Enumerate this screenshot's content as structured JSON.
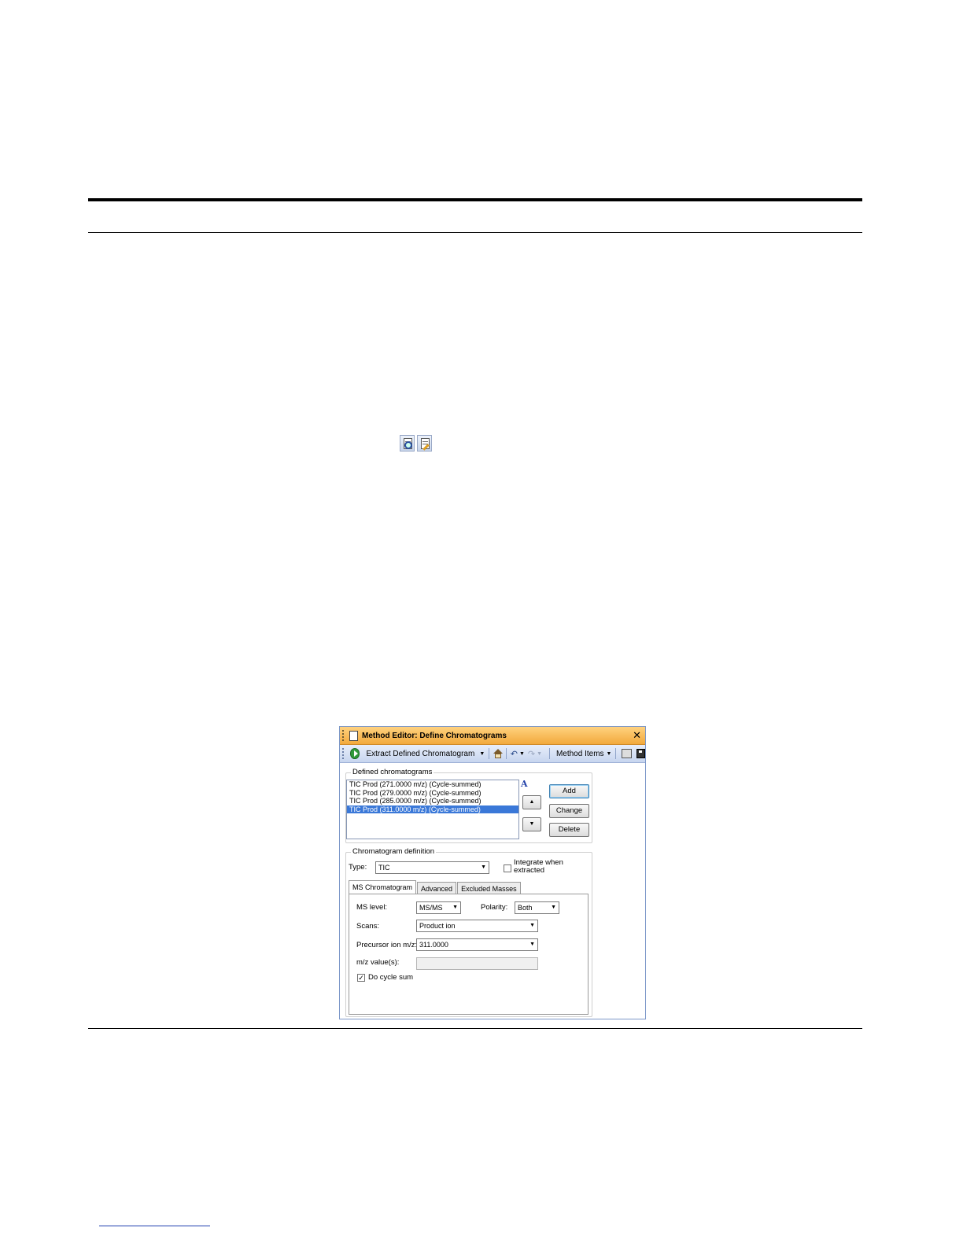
{
  "window": {
    "title": "Method Editor: Define Chromatograms",
    "close_glyph": "✕"
  },
  "command_bar": {
    "extract_label": "Extract Defined Chromatogram",
    "method_items_label": "Method Items",
    "icons": [
      "run-icon",
      "home-icon",
      "undo-icon",
      "redo-icon",
      "print-icon",
      "save-icon"
    ]
  },
  "defined": {
    "group_label": "Defined chromatograms",
    "items": [
      "TIC Prod (271.0000 m/z) (Cycle-summed)",
      "TIC Prod (279.0000 m/z) (Cycle-summed)",
      "TIC Prod (285.0000 m/z) (Cycle-summed)",
      "TIC Prod (311.0000 m/z) (Cycle-summed)"
    ],
    "selected_index": 3,
    "buttons": {
      "add": "Add",
      "change": "Change",
      "delete": "Delete"
    }
  },
  "definition": {
    "group_label": "Chromatogram definition",
    "type_label": "Type:",
    "type_value": "TIC",
    "integrate_label_1": "Integrate when",
    "integrate_label_2": "extracted",
    "integrate_checked": false,
    "tabs": [
      "MS Chromatogram",
      "Advanced",
      "Excluded Masses"
    ],
    "active_tab": 0,
    "ms_level_label": "MS level:",
    "ms_level_value": "MS/MS",
    "polarity_label": "Polarity:",
    "polarity_value": "Both",
    "scans_label": "Scans:",
    "scans_value": "Product ion",
    "precursor_label": "Precursor ion m/z:",
    "precursor_value": "311.0000",
    "mz_values_label": "m/z value(s):",
    "mz_values_value": "",
    "cycle_sum_label": "Do cycle sum",
    "cycle_sum_checked": true
  }
}
